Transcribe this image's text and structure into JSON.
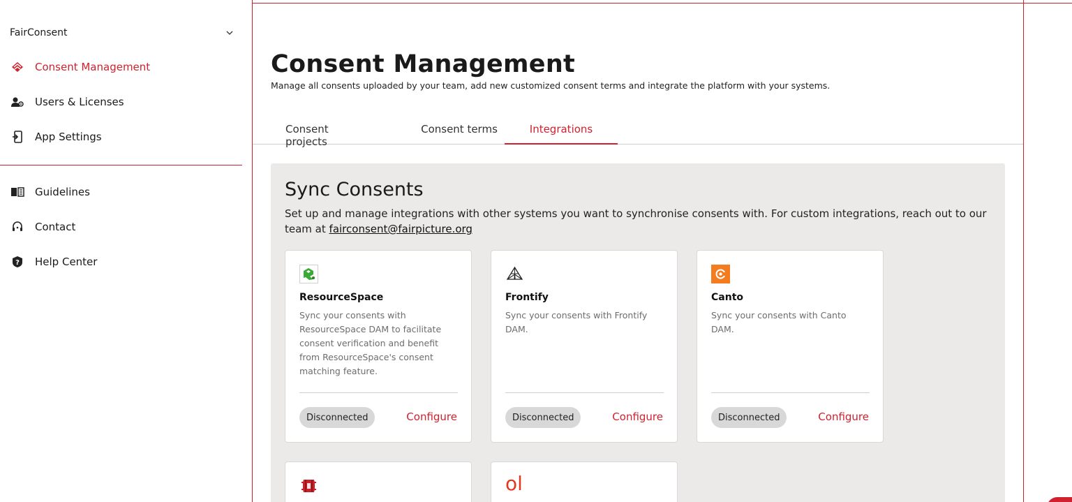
{
  "sidebar": {
    "org_name": "FairConsent",
    "items": [
      {
        "label": "Consent Management",
        "icon": "consent-logo-icon",
        "active": true
      },
      {
        "label": "Users & Licenses",
        "icon": "users-icon",
        "active": false
      },
      {
        "label": "App Settings",
        "icon": "app-settings-icon",
        "active": false
      },
      {
        "label": "Guidelines",
        "icon": "book-icon",
        "active": false
      },
      {
        "label": "Contact",
        "icon": "headset-icon",
        "active": false
      },
      {
        "label": "Help Center",
        "icon": "help-icon",
        "active": false
      }
    ]
  },
  "header": {
    "title": "Consent Management",
    "subtitle": "Manage all consents uploaded by your team, add new customized consent terms and integrate the platform with your systems."
  },
  "tabs": [
    {
      "label": "Consent projects",
      "active": false
    },
    {
      "label": "Consent terms",
      "active": false
    },
    {
      "label": "Integrations",
      "active": true
    }
  ],
  "panel": {
    "title": "Sync Consents",
    "description": "Set up and manage integrations with other systems you want to synchronise consents with. For custom integrations, reach out to our team at",
    "email": "fairconsent@fairpicture.org"
  },
  "integrations": [
    {
      "name": "ResourceSpace",
      "description": "Sync your consents with ResourceSpace DAM to facilitate consent verification and benefit from ResourceSpace's consent matching feature.",
      "status": "Disconnected",
      "action": "Configure",
      "icon": "resourcespace-logo-icon"
    },
    {
      "name": "Frontify",
      "description": "Sync your consents with Frontify DAM.",
      "status": "Disconnected",
      "action": "Configure",
      "icon": "frontify-logo-icon"
    },
    {
      "name": "Canto",
      "description": "Sync your consents with Canto DAM.",
      "status": "Disconnected",
      "action": "Configure",
      "icon": "canto-logo-icon"
    },
    {
      "name": "",
      "description": "",
      "icon": "aws-s3-logo-icon"
    },
    {
      "name": "",
      "logo_text": "ol",
      "icon": "ol-logo-icon"
    }
  ],
  "colors": {
    "accent": "#d0212e",
    "panel_bg": "#ebeae8",
    "badge_bg": "#d8d8d8",
    "resourcespace_green": "#3aa935",
    "canto_orange": "#f47c20",
    "aws_red": "#c7222a"
  }
}
